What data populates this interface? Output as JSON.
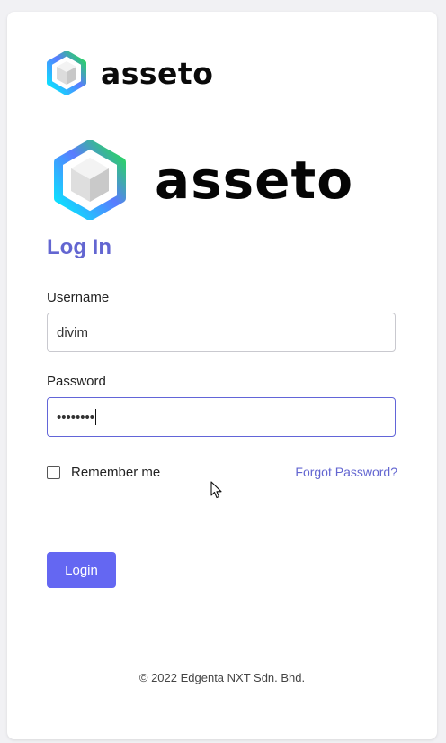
{
  "brand": {
    "name": "asseto",
    "large_name": "asseto"
  },
  "form": {
    "title": "Log In",
    "username_label": "Username",
    "username_value": "divim",
    "password_label": "Password",
    "password_mask": "••••••••",
    "remember_label": "Remember me",
    "remember_checked": false,
    "forgot_label": "Forgot Password?",
    "login_label": "Login"
  },
  "footer": {
    "copyright": "© 2022 Edgenta NXT Sdn. Bhd."
  },
  "colors": {
    "accent": "#6366d1",
    "button": "#6467f2",
    "logo_gradient_start": "#00f0ff",
    "logo_gradient_end": "#22e24a"
  },
  "icons": {
    "logo": "hexagon-cube-logo-icon",
    "cursor": "mouse-pointer-icon"
  }
}
